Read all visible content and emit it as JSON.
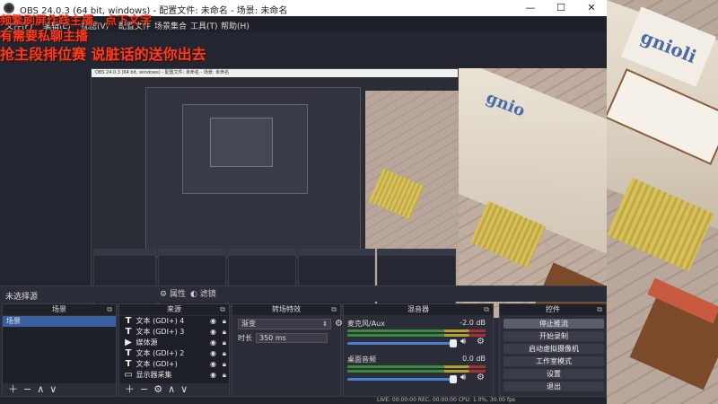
{
  "titlebar": {
    "title": "OBS 24.0.3 (64 bit, windows) - 配置文件: 未命名 - 场景: 未命名",
    "min": "—",
    "max": "☐",
    "close": "✕"
  },
  "menu": {
    "items": [
      "文件(F)",
      "编辑(E)",
      "视图(V)",
      "配置文件",
      "场景集合",
      "工具(T)",
      "帮助(H)"
    ]
  },
  "overlay": {
    "line1": "频繁刷屏作践主播，点下文字",
    "line2": "有需要私聊主播",
    "line3": "抢主段排位赛 说脏话的送你出去"
  },
  "inner_window": {
    "title": "OBS 24.0.3 (64 bit, windows) - 配置文件: 未命名 - 场景: 未命名"
  },
  "source_bar": {
    "label": "未选择源",
    "properties": "属性",
    "filters": "滤镜"
  },
  "scenes": {
    "title": "场景",
    "items": [
      "场景"
    ]
  },
  "sources": {
    "title": "来源",
    "items": [
      {
        "icon": "T",
        "label": "文本 (GDI+) 4"
      },
      {
        "icon": "T",
        "label": "文本 (GDI+) 3"
      },
      {
        "icon": "▶",
        "label": "媒体源"
      },
      {
        "icon": "T",
        "label": "文本 (GDI+) 2"
      },
      {
        "icon": "T",
        "label": "文本 (GDI+)"
      },
      {
        "icon": "▭",
        "label": "显示器采集"
      }
    ]
  },
  "transitions": {
    "title": "转场特效",
    "selected": "渐变",
    "duration_label": "时长",
    "duration_value": "350 ms"
  },
  "mixer": {
    "title": "混音器",
    "channels": [
      {
        "name": "麦克风/Aux",
        "db": "-2.0 dB"
      },
      {
        "name": "桌面音频",
        "db": "0.0 dB"
      }
    ]
  },
  "controls": {
    "title": "控件",
    "buttons": [
      "停止推流",
      "开始录制",
      "启动虚拟摄像机",
      "工作室模式",
      "设置",
      "退出"
    ]
  },
  "status": {
    "text": "LIVE: 00:00:00   REC: 00:00:00   CPU: 1.0%, 30.00 fps"
  },
  "colors": {
    "accent": "#3a5f9e",
    "overlay_text": "#ff3a1e"
  }
}
